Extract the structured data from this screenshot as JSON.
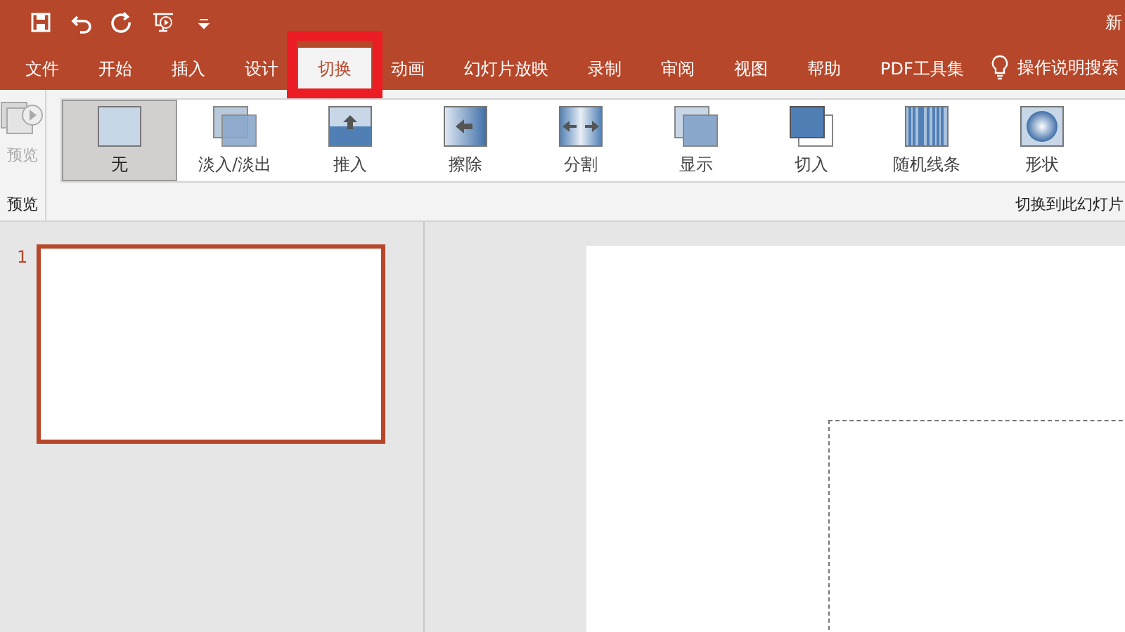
{
  "quick_access": [
    {
      "kind": "save"
    },
    {
      "kind": "undo"
    },
    {
      "kind": "redo"
    },
    {
      "kind": "present"
    },
    {
      "kind": "customize"
    }
  ],
  "window": {
    "title": "新"
  },
  "tabs": [
    {
      "label": "文件",
      "selected": false,
      "highlighted": false
    },
    {
      "label": "开始",
      "selected": false,
      "highlighted": false
    },
    {
      "label": "插入",
      "selected": false,
      "highlighted": false
    },
    {
      "label": "设计",
      "selected": false,
      "highlighted": false
    },
    {
      "label": "切换",
      "selected": true,
      "highlighted": true
    },
    {
      "label": "动画",
      "selected": false,
      "highlighted": false
    },
    {
      "label": "幻灯片放映",
      "selected": false,
      "highlighted": false
    },
    {
      "label": "录制",
      "selected": false,
      "highlighted": false
    },
    {
      "label": "审阅",
      "selected": false,
      "highlighted": false
    },
    {
      "label": "视图",
      "selected": false,
      "highlighted": false
    },
    {
      "label": "帮助",
      "selected": false,
      "highlighted": false
    },
    {
      "label": "PDF工具集",
      "selected": false,
      "highlighted": false
    }
  ],
  "tell_me": {
    "label": "操作说明搜索"
  },
  "ribbon": {
    "preview_group": {
      "button": {
        "label": "预览",
        "disabled": true
      },
      "group_label": "预览"
    },
    "transitions": [
      {
        "label": "无",
        "kind": "none",
        "selected": true
      },
      {
        "label": "淡入/淡出",
        "kind": "fade",
        "selected": false
      },
      {
        "label": "推入",
        "kind": "push",
        "selected": false
      },
      {
        "label": "擦除",
        "kind": "wipe",
        "selected": false
      },
      {
        "label": "分割",
        "kind": "split",
        "selected": false
      },
      {
        "label": "显示",
        "kind": "reveal",
        "selected": false
      },
      {
        "label": "切入",
        "kind": "cut",
        "selected": false
      },
      {
        "label": "随机线条",
        "kind": "bars",
        "selected": false
      },
      {
        "label": "形状",
        "kind": "shape",
        "selected": false
      }
    ],
    "transitions_group_label": "切换到此幻灯片"
  },
  "slides": [
    {
      "number": "1",
      "selected": true
    }
  ]
}
